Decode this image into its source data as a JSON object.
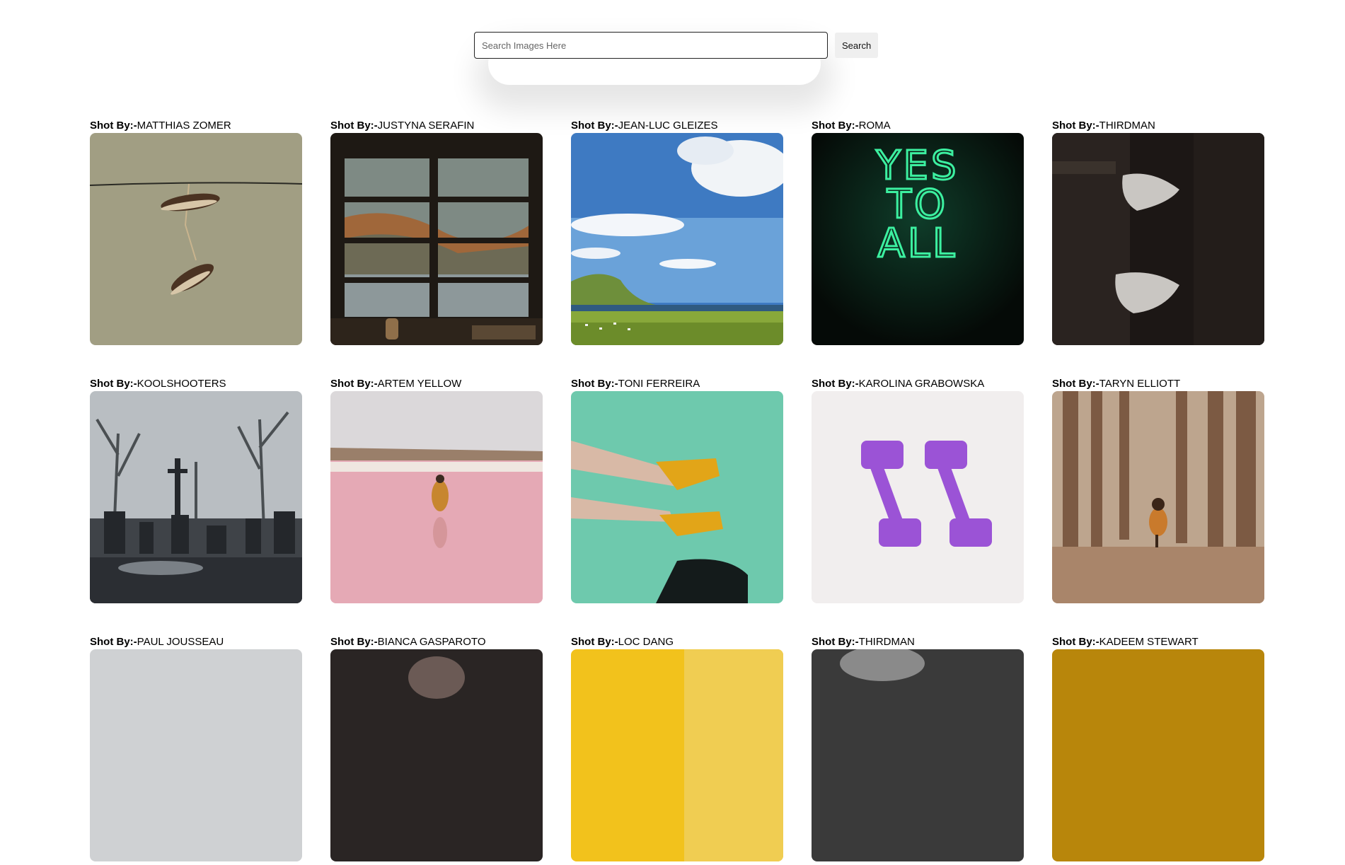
{
  "search": {
    "placeholder": "Search Images Here",
    "value": "",
    "button_label": "Search"
  },
  "photos": [
    {
      "prefix": "Shot By:-",
      "author": "MATTHIAS ZOMER",
      "subject": "sneakers-on-wire"
    },
    {
      "prefix": "Shot By:-",
      "author": "JUSTYNA SERAFIN",
      "subject": "window-view"
    },
    {
      "prefix": "Shot By:-",
      "author": "JEAN-LUC GLEIZES",
      "subject": "coastal-landscape"
    },
    {
      "prefix": "Shot By:-",
      "author": "ROMA",
      "subject": "neon-sign"
    },
    {
      "prefix": "Shot By:-",
      "author": "THIRDMAN",
      "subject": "hands-behind-door"
    },
    {
      "prefix": "Shot By:-",
      "author": "KOOLSHOOTERS",
      "subject": "foggy-cemetery"
    },
    {
      "prefix": "Shot By:-",
      "author": "ARTEM YELLOW",
      "subject": "pink-lake"
    },
    {
      "prefix": "Shot By:-",
      "author": "TONI FERREIRA",
      "subject": "yellow-sneakers-over-water"
    },
    {
      "prefix": "Shot By:-",
      "author": "KAROLINA GRABOWSKA",
      "subject": "purple-dumbbells"
    },
    {
      "prefix": "Shot By:-",
      "author": "TARYN ELLIOTT",
      "subject": "girl-in-forest"
    },
    {
      "prefix": "Shot By:-",
      "author": "PAUL JOUSSEAU",
      "subject": "grey-photo"
    },
    {
      "prefix": "Shot By:-",
      "author": "BIANCA GASPAROTO",
      "subject": "dark-portrait"
    },
    {
      "prefix": "Shot By:-",
      "author": "LOC DANG",
      "subject": "yellow-photo"
    },
    {
      "prefix": "Shot By:-",
      "author": "THIRDMAN",
      "subject": "dark-photo"
    },
    {
      "prefix": "Shot By:-",
      "author": "KADEEM STEWART",
      "subject": "amber-photo"
    }
  ],
  "neon_text": [
    "YES",
    "TO",
    "ALL"
  ]
}
